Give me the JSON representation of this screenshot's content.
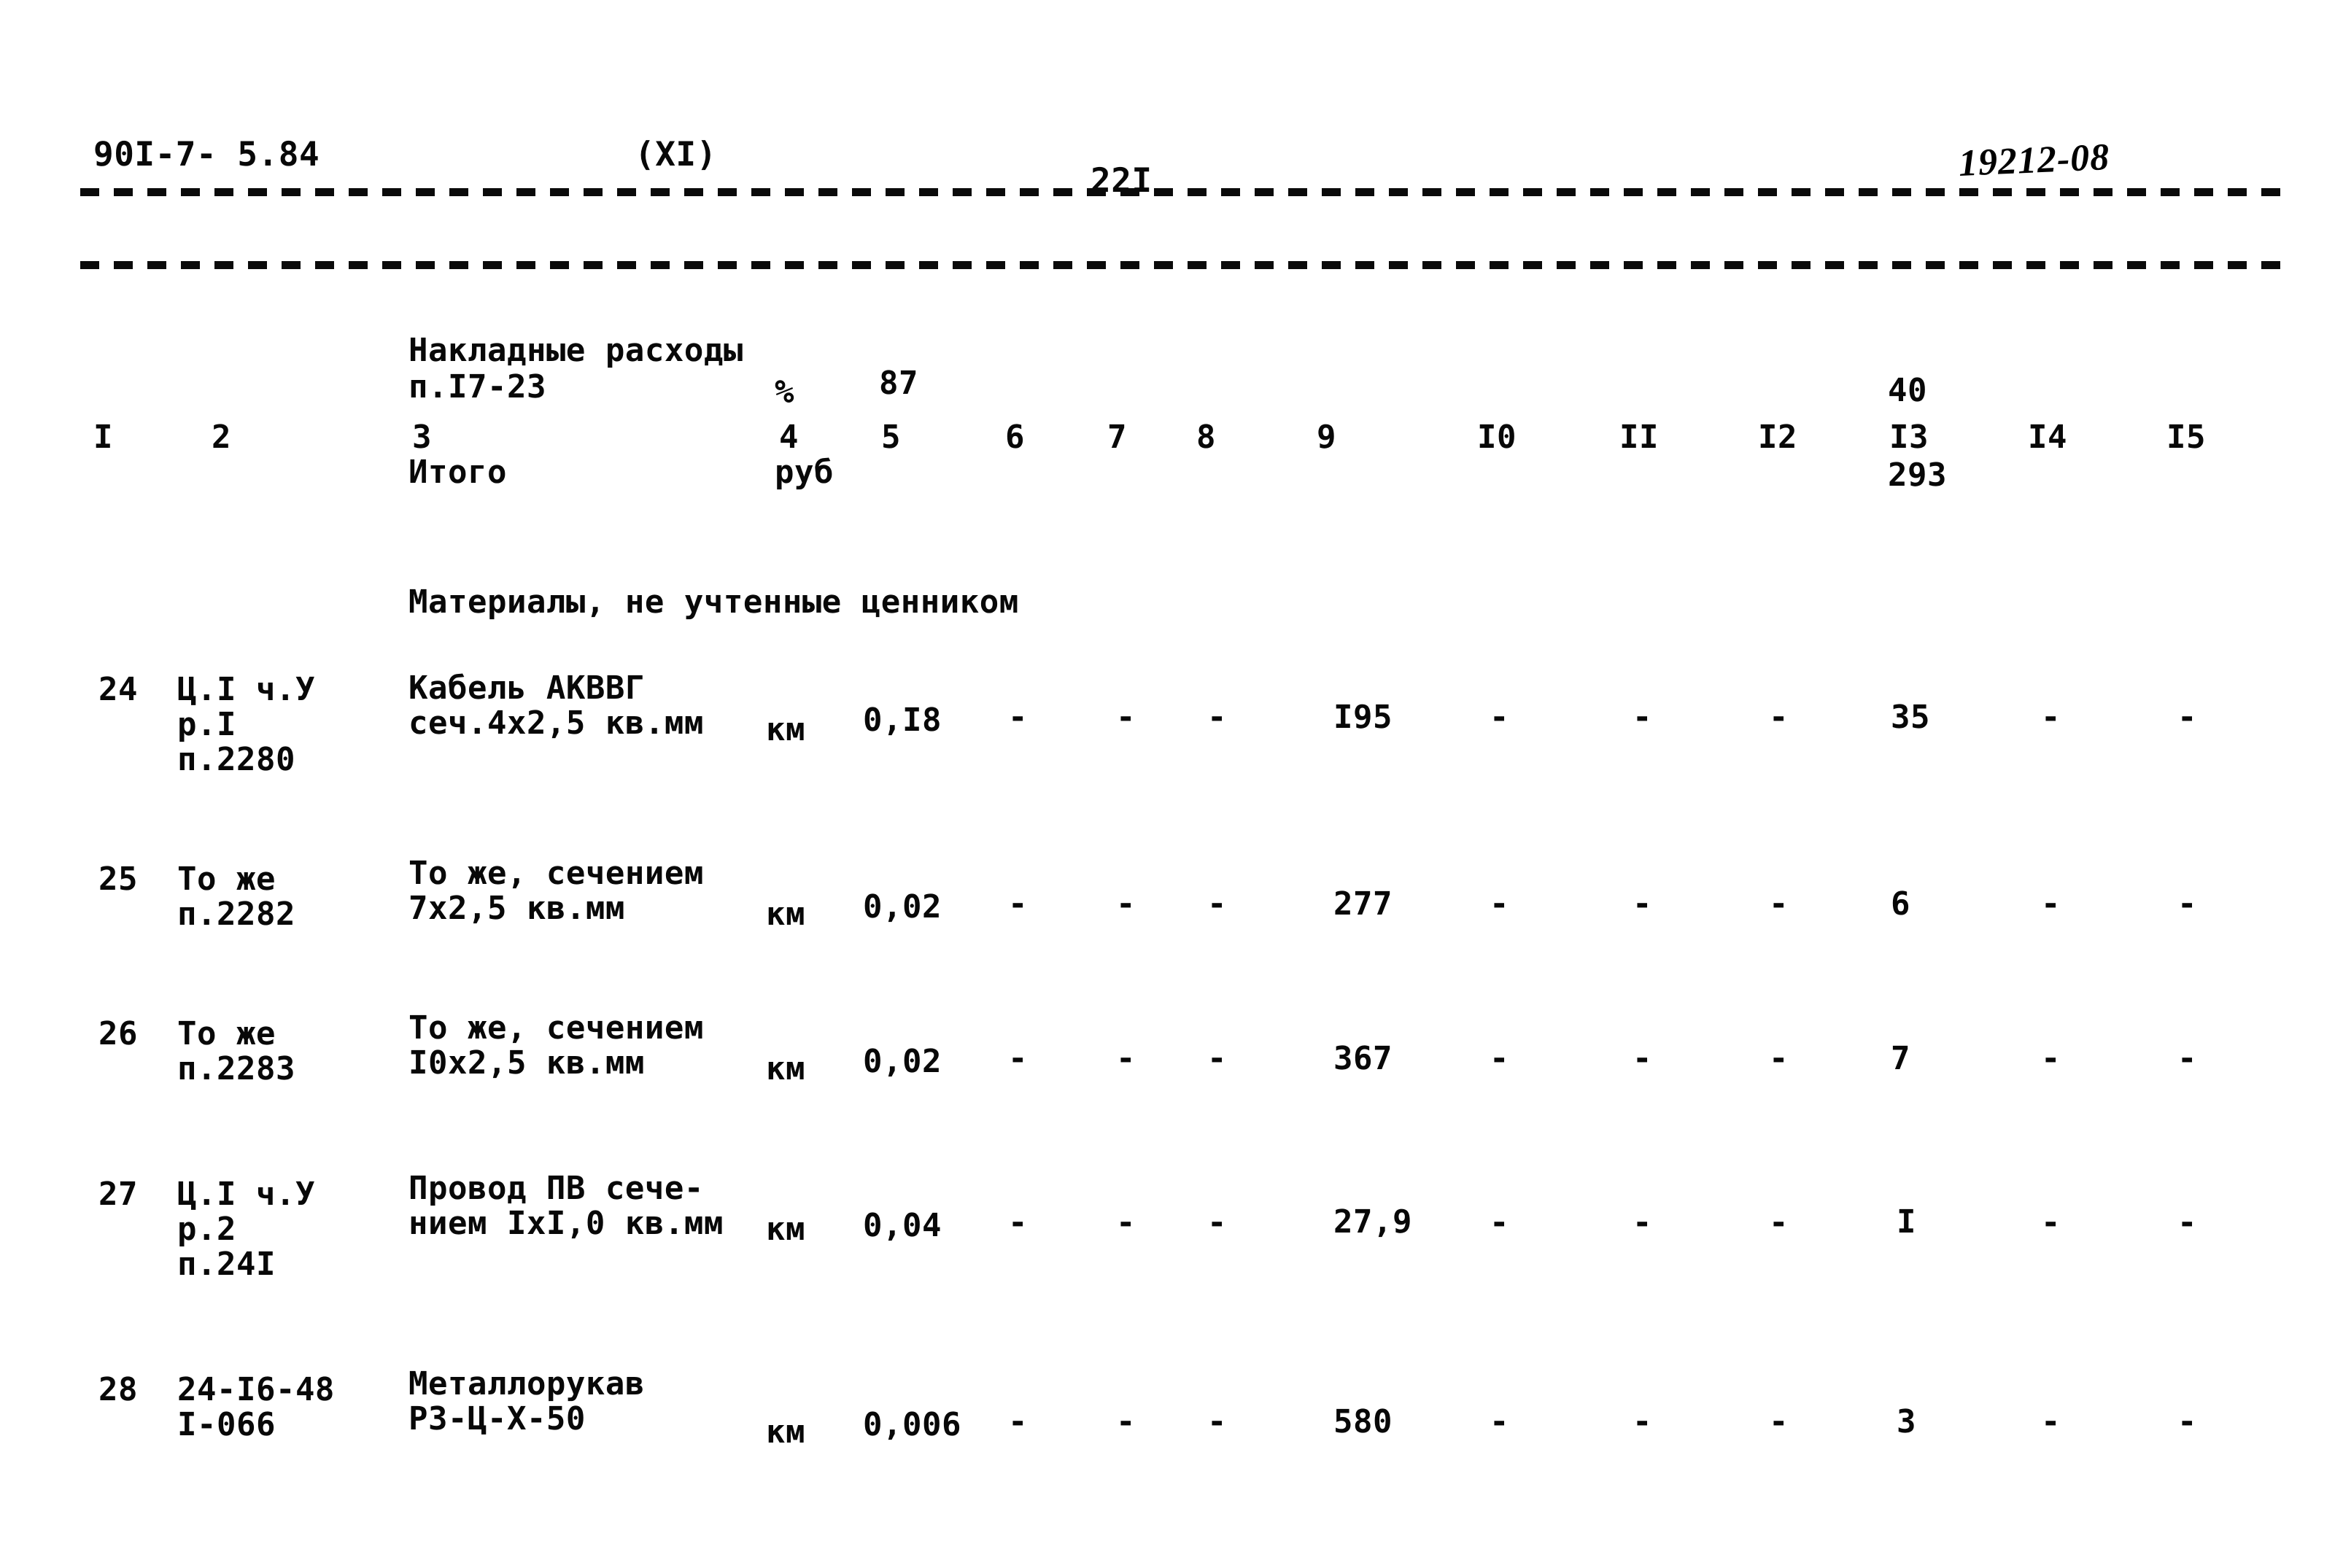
{
  "header": {
    "doc_code": "90I-7- 5.84",
    "section": "(XI)",
    "page_number": "22I",
    "stamp": "19212-08"
  },
  "column_numbers": [
    "I",
    "2",
    "3",
    "4",
    "5",
    "6",
    "7",
    "8",
    "9",
    "I0",
    "II",
    "I2",
    "I3",
    "I4",
    "I5"
  ],
  "summary_rows": [
    {
      "label_line1": "Накладные расходы",
      "label_line2": "п.I7-23",
      "unit": "%",
      "col5": "87",
      "col13": "40"
    },
    {
      "label_line1": "Итого",
      "label_line2": "",
      "unit": "руб",
      "col5": "",
      "col13": "293"
    }
  ],
  "section_heading": "Материалы, не учтенные ценником",
  "dash": "-",
  "items": [
    {
      "no": "24",
      "ref_line1": "Ц.I ч.У",
      "ref_line2": "р.I",
      "ref_line3": "п.2280",
      "desc_line1": "Кабель АКВВГ",
      "desc_line2": "сеч.4х2,5 кв.мм",
      "unit": "км",
      "qty": "0,I8",
      "col6": "-",
      "col7": "-",
      "col8": "-",
      "col9": "I95",
      "col10": "-",
      "col11": "-",
      "col12": "-",
      "col13": "35",
      "col14": "-",
      "col15": "-"
    },
    {
      "no": "25",
      "ref_line1": "То же",
      "ref_line2": "п.2282",
      "ref_line3": "",
      "desc_line1": "То же, сечением",
      "desc_line2": "7х2,5 кв.мм",
      "unit": "км",
      "qty": "0,02",
      "col6": "-",
      "col7": "-",
      "col8": "-",
      "col9": "277",
      "col10": "-",
      "col11": "-",
      "col12": "-",
      "col13": "6",
      "col14": "-",
      "col15": "-"
    },
    {
      "no": "26",
      "ref_line1": "То же",
      "ref_line2": "п.2283",
      "ref_line3": "",
      "desc_line1": "То же, сечением",
      "desc_line2": "I0х2,5 кв.мм",
      "unit": "км",
      "qty": "0,02",
      "col6": "-",
      "col7": "-",
      "col8": "-",
      "col9": "367",
      "col10": "-",
      "col11": "-",
      "col12": "-",
      "col13": "7",
      "col14": "-",
      "col15": "-"
    },
    {
      "no": "27",
      "ref_line1": "Ц.I ч.У",
      "ref_line2": "р.2",
      "ref_line3": "п.24I",
      "desc_line1": "Провод ПВ сече-",
      "desc_line2": "нием IxI,0 кв.мм",
      "unit": "км",
      "qty": "0,04",
      "col6": "-",
      "col7": "-",
      "col8": "-",
      "col9": "27,9",
      "col10": "-",
      "col11": "-",
      "col12": "-",
      "col13": "I",
      "col14": "-",
      "col15": "-"
    },
    {
      "no": "28",
      "ref_line1": "24-I6-48",
      "ref_line2": "I-066",
      "ref_line3": "",
      "desc_line1": "Металлорукав",
      "desc_line2": "РЗ-Ц-Х-50",
      "unit": "км",
      "qty": "0,006",
      "col6": "-",
      "col7": "-",
      "col8": "-",
      "col9": "580",
      "col10": "-",
      "col11": "-",
      "col12": "-",
      "col13": "3",
      "col14": "-",
      "col15": "-"
    }
  ]
}
